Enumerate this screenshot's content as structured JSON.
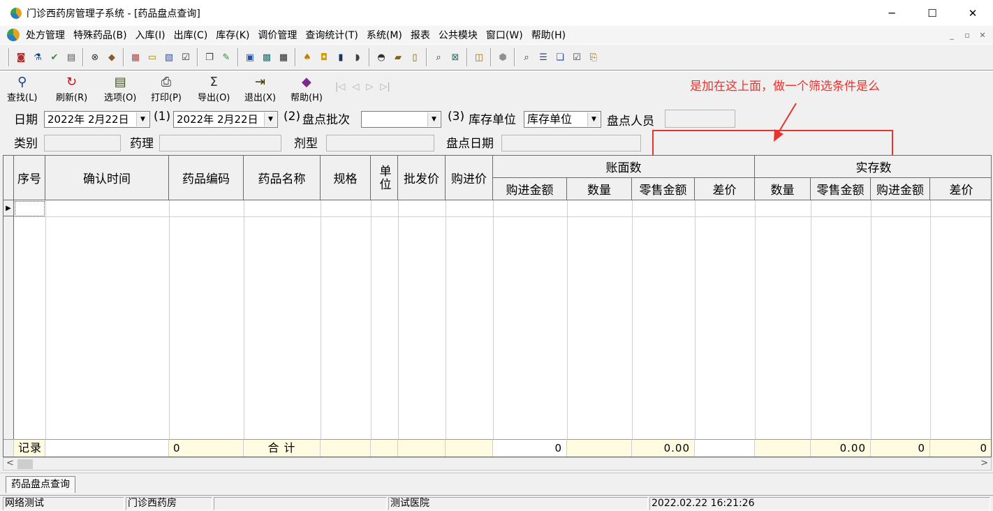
{
  "window": {
    "title": "门诊西药房管理子系统 - [药品盘点查询]",
    "controls": [
      "─",
      "☐",
      "✕"
    ]
  },
  "menubar": {
    "items": [
      "处方管理",
      "特殊药品(B)",
      "入库(I)",
      "出库(C)",
      "库存(K)",
      "调价管理",
      "查询统计(T)",
      "系统(M)",
      "报表",
      "公共模块",
      "窗口(W)",
      "帮助(H)"
    ],
    "mdi_controls": [
      "_",
      "▫",
      "✕"
    ]
  },
  "toolbar_icons": [
    {
      "name": "record-icon",
      "glyph": "◙",
      "color": "#b03030"
    },
    {
      "name": "bottle-icon",
      "glyph": "⚗",
      "color": "#1a3e8a"
    },
    {
      "name": "check-icon",
      "glyph": "✔",
      "color": "#2f8f2f"
    },
    {
      "name": "document-icon",
      "glyph": "▤",
      "color": "#555555"
    },
    {
      "name": "binoculars-icon",
      "glyph": "⊗",
      "color": "#333333"
    },
    {
      "name": "bag-icon",
      "glyph": "◆",
      "color": "#8a5a2a"
    },
    {
      "name": "invoice-icon",
      "glyph": "▦",
      "color": "#c04040"
    },
    {
      "name": "card-icon",
      "glyph": "▭",
      "color": "#a08020"
    },
    {
      "name": "paste-icon",
      "glyph": "▧",
      "color": "#3050a0"
    },
    {
      "name": "checkmark-list-icon",
      "glyph": "☑",
      "color": "#303030"
    },
    {
      "name": "copy-icon",
      "glyph": "❐",
      "color": "#404040"
    },
    {
      "name": "edit-check-icon",
      "glyph": "✎",
      "color": "#3a8a3a"
    },
    {
      "name": "form-icon",
      "glyph": "▣",
      "color": "#2050b0"
    },
    {
      "name": "screen-icon",
      "glyph": "▩",
      "color": "#207070"
    },
    {
      "name": "grid-icon",
      "glyph": "▦",
      "color": "#202020"
    },
    {
      "name": "bell-icon",
      "glyph": "♠",
      "color": "#c08000"
    },
    {
      "name": "pm-icon",
      "glyph": "◘",
      "color": "#d0a000"
    },
    {
      "name": "lock-icon",
      "glyph": "▮",
      "color": "#203060"
    },
    {
      "name": "pill-icon",
      "glyph": "◗",
      "color": "#404040"
    },
    {
      "name": "binoculars2-icon",
      "glyph": "◓",
      "color": "#303030"
    },
    {
      "name": "folder-icon",
      "glyph": "▰",
      "color": "#806020"
    },
    {
      "name": "thermometer-icon",
      "glyph": "▯",
      "color": "#806000"
    },
    {
      "name": "search-icon",
      "glyph": "⌕",
      "color": "#303030"
    },
    {
      "name": "close-box-icon",
      "glyph": "⊠",
      "color": "#207070"
    },
    {
      "name": "open-folder-icon",
      "glyph": "◫",
      "color": "#a07010"
    },
    {
      "name": "hexagon-icon",
      "glyph": "⬢",
      "color": "#909090"
    },
    {
      "name": "zoom-icon",
      "glyph": "⌕",
      "color": "#303030"
    },
    {
      "name": "list-icon",
      "glyph": "☰",
      "color": "#2040a0"
    },
    {
      "name": "windows-icon",
      "glyph": "❏",
      "color": "#2040a0"
    },
    {
      "name": "approve-icon",
      "glyph": "☑",
      "color": "#404040"
    },
    {
      "name": "export-doc-icon",
      "glyph": "⎘",
      "color": "#806000"
    }
  ],
  "toolbar_actions": [
    {
      "label": "查找(L)",
      "icon": "search-icon",
      "glyph": "⚲",
      "color": "#1a3e8a"
    },
    {
      "label": "刷新(R)",
      "icon": "refresh-icon",
      "glyph": "↻",
      "color": "#cc1010"
    },
    {
      "label": "选项(O)",
      "icon": "options-icon",
      "glyph": "▤",
      "color": "#405020"
    },
    {
      "label": "打印(P)",
      "icon": "printer-icon",
      "glyph": "⎙",
      "color": "#303030"
    },
    {
      "label": "导出(O)",
      "icon": "sigma-icon",
      "glyph": "Σ",
      "color": "#303030"
    },
    {
      "label": "退出(X)",
      "icon": "exit-door-icon",
      "glyph": "⇥",
      "color": "#403000"
    },
    {
      "label": "帮助(H)",
      "icon": "help-book-icon",
      "glyph": "◆",
      "color": "#7a2a8a"
    }
  ],
  "record_nav": [
    "|◁",
    "◁",
    "▷",
    "▷|"
  ],
  "annotation": {
    "text": "是加在这上面，做一个筛选条件是么",
    "color": "#e8332f"
  },
  "filters": {
    "date_label": "日期",
    "date_from": "2022年  2月22日",
    "marker1": "(1)",
    "date_to": "2022年  2月22日",
    "marker2": "(2)",
    "batch_label": "盘点批次",
    "batch_value": "",
    "marker3": "(3)",
    "unit_label": "库存单位",
    "unit_value": "库存单位",
    "staff_label": "盘点人员",
    "staff_value": "",
    "category_label": "类别",
    "category_value": "",
    "pharmacology_label": "药理",
    "pharmacology_value": "",
    "dosage_label": "剂型",
    "dosage_value": "",
    "check_date_label": "盘点日期",
    "check_date_value": ""
  },
  "grid": {
    "columns": [
      "序号",
      "确认时间",
      "药品编码",
      "药品名称",
      "规格",
      "单位",
      "批发价",
      "购进价"
    ],
    "group_book": "账面数",
    "book_columns": [
      "购进金额",
      "数量",
      "零售金额",
      "差价"
    ],
    "group_actual": "实存数",
    "actual_columns": [
      "数量",
      "零售金额",
      "购进金额",
      "差价"
    ],
    "footer": {
      "records_label": "记录",
      "records_count": "0",
      "total_label": "合   计",
      "book_purchase_amount": "0",
      "book_retail_amount": "0.00",
      "actual_retail_amount": "0.00",
      "actual_purchase_amount": "0",
      "actual_diff": "0"
    }
  },
  "tab": {
    "label": "药品盘点查询"
  },
  "statusbar": {
    "network": "网络测试",
    "department": "门诊西药房",
    "blank": "",
    "hospital": "测试医院",
    "datetime": "2022.02.22 16:21:26"
  }
}
